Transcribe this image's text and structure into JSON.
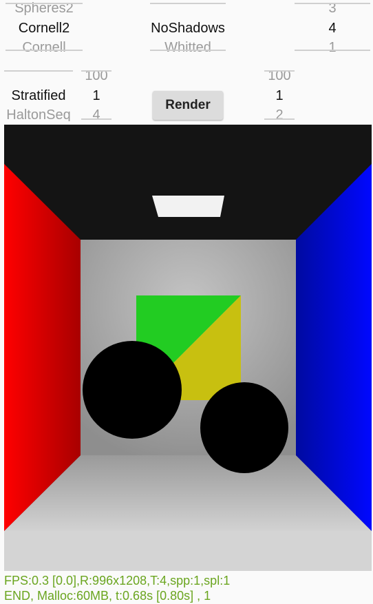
{
  "pickers": {
    "scene": {
      "above": "Spheres2",
      "selected": "Cornell2",
      "below": "Cornell"
    },
    "shading": {
      "above": "",
      "selected": "NoShadows",
      "below": "Whitted"
    },
    "threads": {
      "above": "3",
      "selected": "4",
      "below": "1"
    },
    "sampler": {
      "above": "",
      "selected": "Stratified",
      "below": "HaltonSeq"
    },
    "spp": {
      "above": "100",
      "selected": "1",
      "below": "4"
    },
    "spl": {
      "above": "100",
      "selected": "1",
      "below": "2"
    }
  },
  "render_button": {
    "label": "Render"
  },
  "status": {
    "line1": "FPS:0.3 [0.0],R:996x1208,T:4,spp:1,spl:1",
    "line2": "END, Malloc:60MB, t:0.68s [0.80s] , 1"
  },
  "colors": {
    "status_text": "#6aa51f",
    "left_wall": "#e00000",
    "right_wall": "#0010e0",
    "ceiling": "#141414",
    "back_wall": "#a8a8a8",
    "floor": "#bdbdbd",
    "light": "#f2f2f2",
    "box_green": "#22cc22",
    "box_yellow": "#c8c010",
    "sphere": "#000000"
  }
}
